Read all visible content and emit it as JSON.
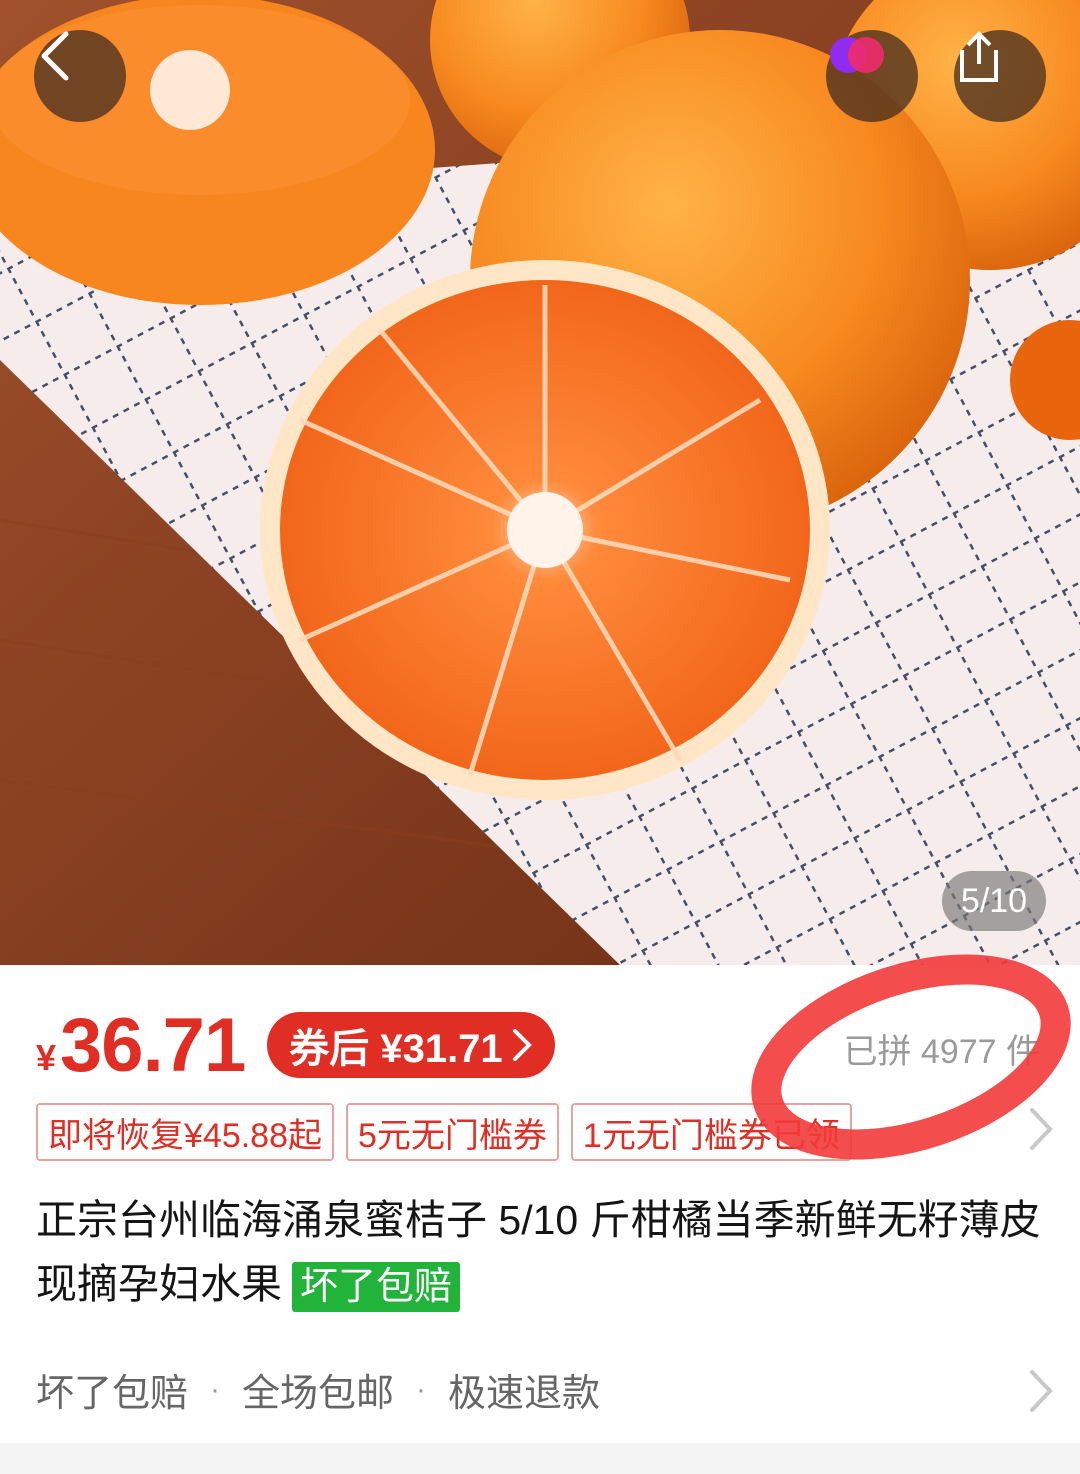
{
  "gallery": {
    "image_alt": "oranges",
    "pager": "5/10"
  },
  "icons": {
    "back": "chevron-left-icon",
    "brand": "app-logo-icon",
    "share": "share-icon"
  },
  "price": {
    "currency": "¥",
    "amount": "36.71",
    "coupon_price": "券后 ¥31.71",
    "sold": "已拼 4977 件"
  },
  "tags": [
    "即将恢复¥45.88起",
    "5元无门槛券",
    "1元无门槛券已领"
  ],
  "product": {
    "title": "正宗台州临海涌泉蜜桔子 5/10 斤柑橘当季新鲜无籽薄皮现摘孕妇水果",
    "badge": "坏了包赔"
  },
  "services": [
    "坏了包赔",
    "全场包邮",
    "极速退款"
  ],
  "colors": {
    "price_red": "#e02e24",
    "badge_green": "#21b33a",
    "annotation_red": "#f23a3a"
  }
}
